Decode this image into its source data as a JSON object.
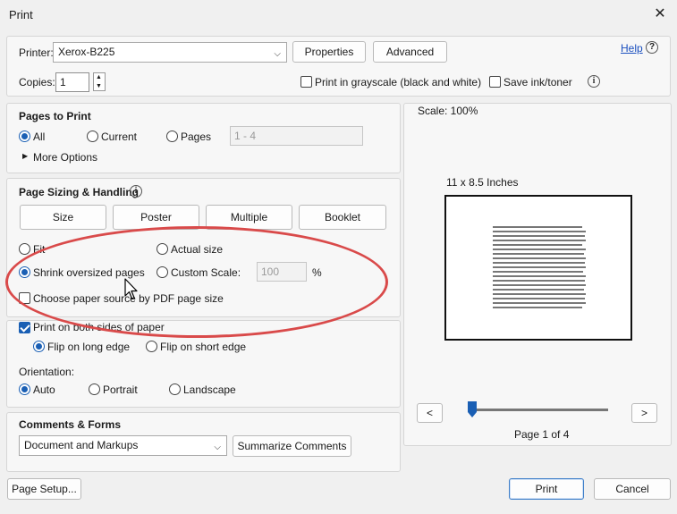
{
  "window": {
    "title": "Print"
  },
  "printer": {
    "label": "Printer:",
    "value": "Xerox-B225",
    "properties_label": "Properties",
    "advanced_label": "Advanced",
    "help_label": "Help"
  },
  "copies": {
    "label": "Copies:",
    "value": "1",
    "grayscale_label": "Print in grayscale (black and white)",
    "save_ink_label": "Save ink/toner"
  },
  "pages_to_print": {
    "title": "Pages to Print",
    "all_label": "All",
    "current_label": "Current",
    "pages_label": "Pages",
    "pages_placeholder": "1 - 4",
    "more_options_label": "More Options"
  },
  "sizing": {
    "title": "Page Sizing & Handling",
    "tabs": [
      "Size",
      "Poster",
      "Multiple",
      "Booklet"
    ],
    "fit_label": "Fit",
    "actual_size_label": "Actual size",
    "shrink_label": "Shrink oversized pages",
    "custom_scale_label": "Custom Scale:",
    "custom_scale_value": "100",
    "percent_label": "%",
    "paper_source_label": "Choose paper source by PDF page size"
  },
  "duplex": {
    "both_sides_label": "Print on both sides of paper",
    "long_edge_label": "Flip on long edge",
    "short_edge_label": "Flip on short edge"
  },
  "orientation": {
    "title": "Orientation:",
    "auto_label": "Auto",
    "portrait_label": "Portrait",
    "landscape_label": "Landscape"
  },
  "comments": {
    "title": "Comments & Forms",
    "selected": "Document and Markups",
    "summarize_label": "Summarize Comments"
  },
  "preview": {
    "scale_label": "Scale: 100%",
    "paper_size": "11 x 8.5 Inches",
    "prev_label": "<",
    "next_label": ">",
    "page_indicator": "Page 1 of 4",
    "slider_position": 0
  },
  "footer": {
    "page_setup_label": "Page Setup...",
    "print_label": "Print",
    "cancel_label": "Cancel"
  },
  "colors": {
    "accent": "#1a5fb4",
    "annotation": "#d94a4a"
  }
}
